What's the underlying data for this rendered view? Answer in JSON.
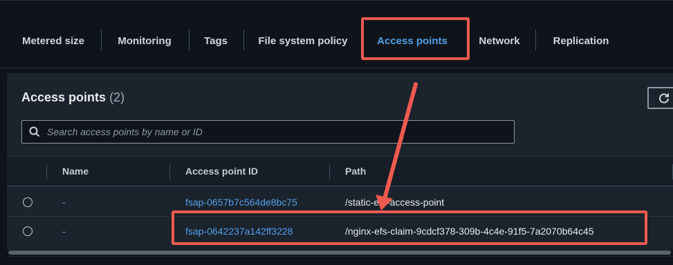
{
  "tabs": [
    {
      "label": "Metered size"
    },
    {
      "label": "Monitoring"
    },
    {
      "label": "Tags"
    },
    {
      "label": "File system policy"
    },
    {
      "label": "Access points",
      "active": true
    },
    {
      "label": "Network"
    },
    {
      "label": "Replication"
    }
  ],
  "panel": {
    "title": "Access points",
    "count": "(2)"
  },
  "search": {
    "placeholder": "Search access points by name or ID"
  },
  "table": {
    "columns": [
      "Name",
      "Access point ID",
      "Path"
    ],
    "rows": [
      {
        "name": "-",
        "id": "fsap-0657b7c564de8bc75",
        "path": "/static-efs-access-point"
      },
      {
        "name": "-",
        "id": "fsap-0642237a142ff3228",
        "path": "/nginx-efs-claim-9cdcf378-309b-4c4e-91f5-7a2070b64c45"
      }
    ]
  },
  "colors": {
    "accent": "#539fe5",
    "annotation": "#ee5a4f",
    "background": "#0f141b",
    "panel": "#1b232d"
  },
  "icons": [
    "search-icon",
    "refresh-icon",
    "radio-button"
  ]
}
